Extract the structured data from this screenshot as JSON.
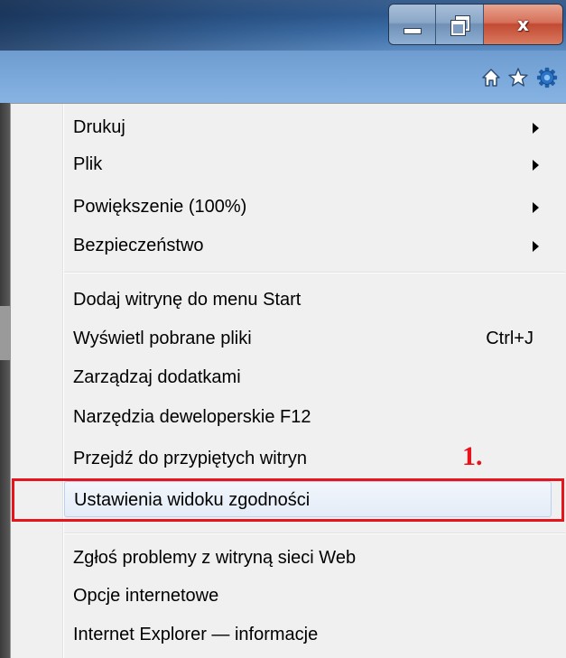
{
  "window": {
    "minimize_label": "",
    "maximize_label": "",
    "close_label": "x"
  },
  "toolbar": {
    "icons": [
      "home-icon",
      "star-icon",
      "gear-icon"
    ]
  },
  "menu": {
    "group1": [
      {
        "label": "Drukuj",
        "submenu": true
      },
      {
        "label": "Plik",
        "submenu": true
      },
      {
        "label": "Powiększenie (100%)",
        "submenu": true
      },
      {
        "label": "Bezpieczeństwo",
        "submenu": true
      }
    ],
    "group2": [
      {
        "label": "Dodaj witrynę do menu Start"
      },
      {
        "label": "Wyświetl pobrane pliki",
        "shortcut": "Ctrl+J"
      },
      {
        "label": "Zarządzaj dodatkami"
      },
      {
        "label": "Narzędzia deweloperskie F12"
      },
      {
        "label": "Przejdź do przypiętych witryn"
      },
      {
        "label": "Ustawienia widoku zgodności",
        "highlighted": true
      }
    ],
    "group3": [
      {
        "label": "Zgłoś problemy z witryną sieci Web"
      },
      {
        "label": "Opcje internetowe"
      },
      {
        "label": "Internet Explorer — informacje"
      }
    ]
  },
  "annotation": {
    "label": "1.",
    "color": "#e8141c"
  },
  "colors": {
    "accent_highlight": "#e4ecf7",
    "annotation_red": "#e8141c"
  }
}
